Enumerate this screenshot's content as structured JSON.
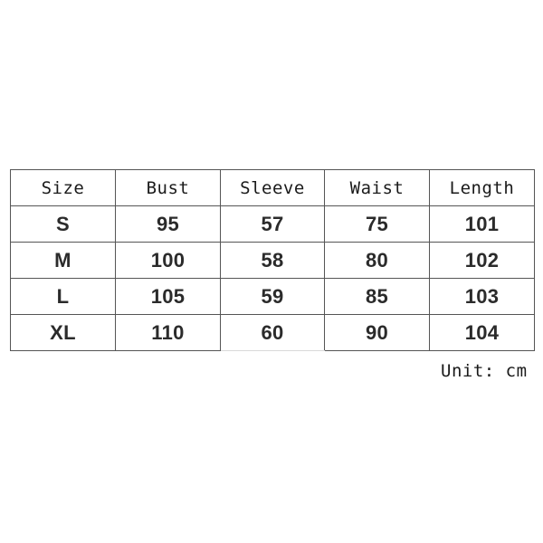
{
  "table": {
    "columns": [
      "Size",
      "Bust",
      "Sleeve",
      "Waist",
      "Length"
    ],
    "rows": [
      {
        "size": "S",
        "bust": "95",
        "sleeve": "57",
        "waist": "75",
        "length": "101"
      },
      {
        "size": "M",
        "bust": "100",
        "sleeve": "58",
        "waist": "80",
        "length": "102"
      },
      {
        "size": "L",
        "bust": "105",
        "sleeve": "59",
        "waist": "85",
        "length": "103"
      },
      {
        "size": "XL",
        "bust": "110",
        "sleeve": "60",
        "waist": "90",
        "length": "104"
      }
    ]
  },
  "unit_note": "Unit: cm",
  "colors": {
    "background": "#ffffff",
    "border": "#555555",
    "header_text": "#1a1a1a",
    "data_text": "#2b2b2b"
  }
}
